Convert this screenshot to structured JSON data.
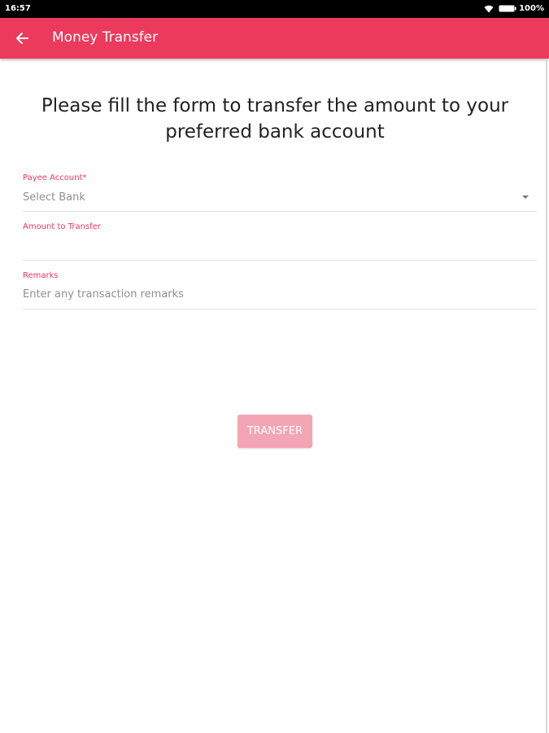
{
  "status_bar": {
    "time": "16:57",
    "battery": "100%",
    "wifi_icon": "wifi-icon",
    "battery_icon": "battery-icon"
  },
  "app_bar": {
    "title": "Money Transfer",
    "back_icon": "back-arrow-icon",
    "background_color": "#ec3a5c"
  },
  "form": {
    "heading": "Please fill the form to transfer the amount to your preferred bank account",
    "payee_account": {
      "label": "Payee Account*",
      "value": "Select Bank"
    },
    "amount": {
      "label": "Amount to Transfer",
      "value": ""
    },
    "remarks": {
      "label": "Remarks",
      "placeholder": "Enter any transaction remarks"
    },
    "submit_label": "TRANSFER",
    "accent_color": "#ec3a5c",
    "submit_color": "#f4a5b5"
  }
}
